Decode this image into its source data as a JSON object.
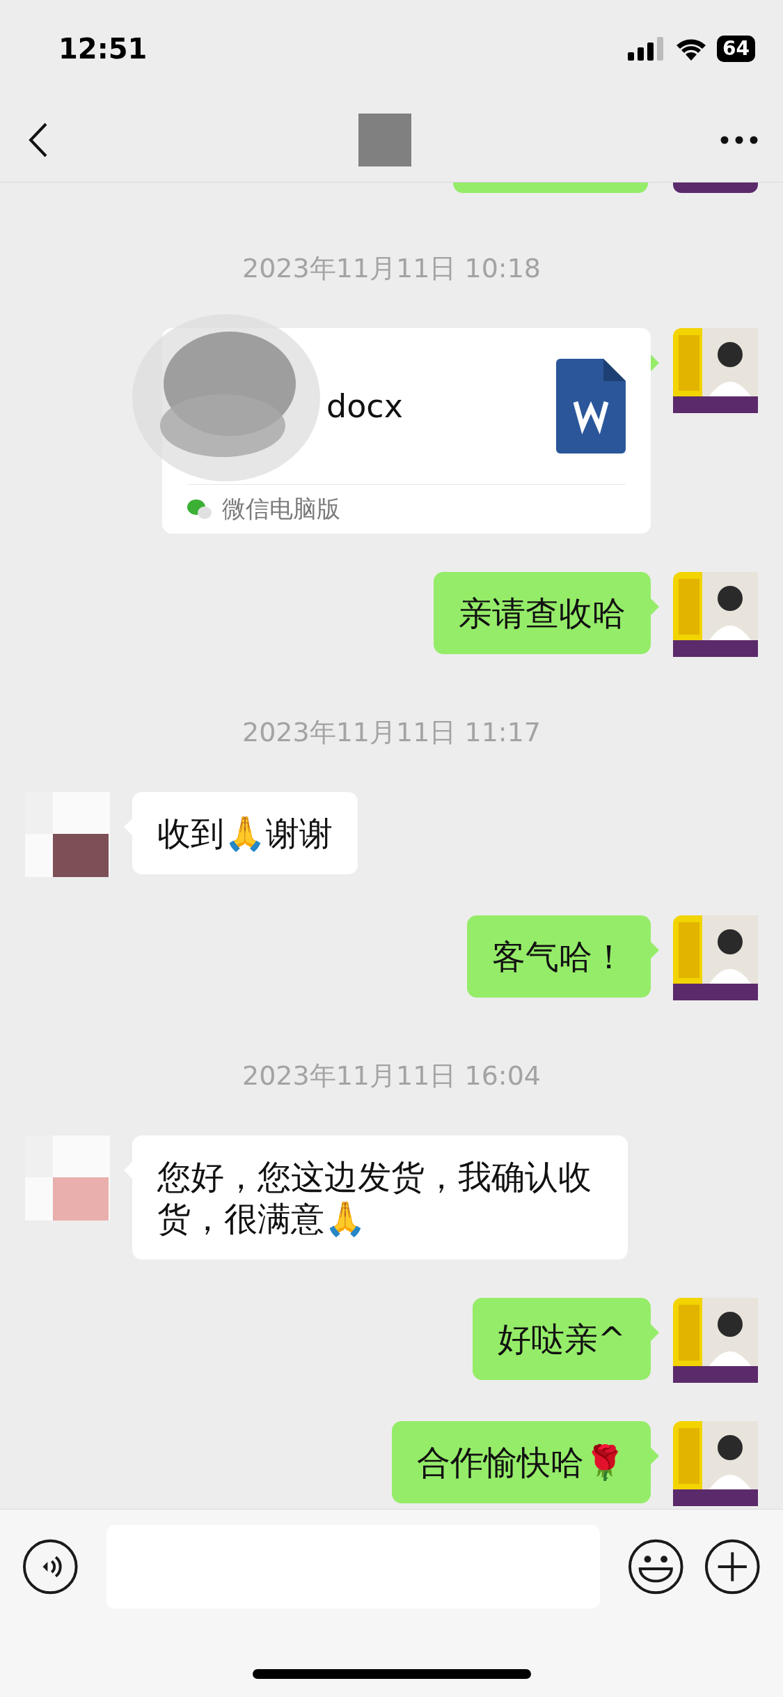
{
  "status_bar": {
    "time": "12:51",
    "battery": "64"
  },
  "messages": [
    {
      "kind": "cut",
      "from_me": true
    },
    {
      "kind": "time",
      "text": "2023年11月11日 10:18"
    },
    {
      "kind": "file",
      "from_me": true,
      "file_name": "docx",
      "source": "微信电脑版"
    },
    {
      "kind": "text",
      "from_me": true,
      "text": "亲请查收哈"
    },
    {
      "kind": "time",
      "text": "2023年11月11日 11:17"
    },
    {
      "kind": "text",
      "from_me": false,
      "text": "收到🙏谢谢"
    },
    {
      "kind": "text",
      "from_me": true,
      "text": "客气哈！"
    },
    {
      "kind": "time",
      "text": "2023年11月11日 16:04"
    },
    {
      "kind": "text",
      "from_me": false,
      "text": "您好，您这边发货，我确认收货，很满意🙏"
    },
    {
      "kind": "text",
      "from_me": true,
      "text": "好哒亲^"
    },
    {
      "kind": "text",
      "from_me": true,
      "text": "合作愉快哈🌹"
    }
  ]
}
